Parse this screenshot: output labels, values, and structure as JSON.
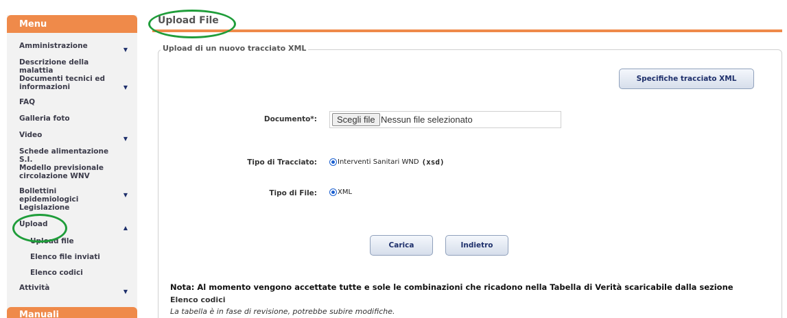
{
  "sidebar": {
    "header": "Menu",
    "items": [
      {
        "label": "Amministrazione",
        "chevron": "▼"
      },
      {
        "label": "Descrizione della malattia",
        "chevron": ""
      },
      {
        "label": "Documenti tecnici ed informazioni",
        "chevron": "▼"
      },
      {
        "label": "FAQ",
        "chevron": ""
      },
      {
        "label": "Galleria foto",
        "chevron": ""
      },
      {
        "label": "Video",
        "chevron": "▼"
      },
      {
        "label": "Schede alimentazione S.I.",
        "chevron": ""
      },
      {
        "label": "Modello previsionale circolazione WNV",
        "chevron": ""
      },
      {
        "label": "Bollettini epidemiologici",
        "chevron": "▼"
      },
      {
        "label": "Legislazione",
        "chevron": ""
      },
      {
        "label": "Upload",
        "chevron": "▲"
      },
      {
        "label": "Attività",
        "chevron": "▼"
      }
    ],
    "upload_subitems": [
      "Upload file",
      "Elenco file inviati",
      "Elenco codici"
    ],
    "footer_header": "Manuali"
  },
  "main": {
    "title": "Upload File",
    "legend": "Upload di un nuovo tracciato XML",
    "spec_button": "Specifiche tracciato XML",
    "documento_label": "Documento*:",
    "file_button": "Scegli file",
    "file_status": "Nessun file selezionato",
    "tracciato_label": "Tipo di Tracciato:",
    "tracciato_option": "Interventi Sanitari WND",
    "tracciato_suffix": "(xsd)",
    "file_label": "Tipo di File:",
    "file_option": "XML",
    "carica_button": "Carica",
    "indietro_button": "Indietro",
    "note_title": "Nota: Al momento vengono accettate tutte e sole le combinazioni che ricadono nella Tabella di Verità scaricabile dalla sezione",
    "note_link": "Elenco codici",
    "note_italic": "La tabella è in fase di revisione, potrebbe subire modifiche."
  },
  "colors": {
    "accent": "#ef8a4a",
    "annotation": "#1f9d3a",
    "button_text": "#1e2f6b"
  }
}
